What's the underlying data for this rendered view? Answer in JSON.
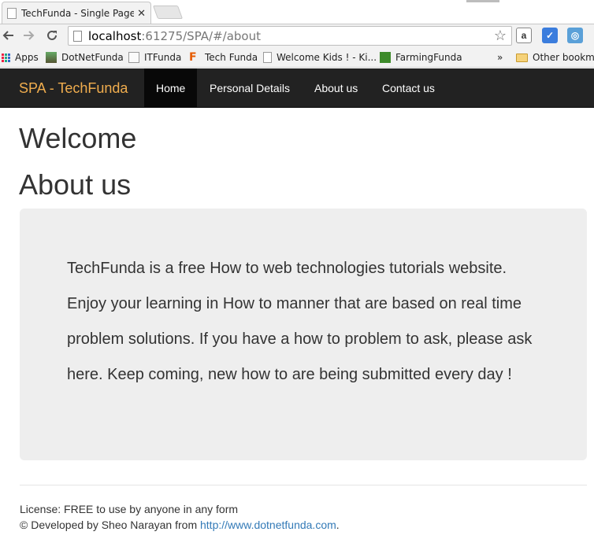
{
  "browser": {
    "tab_title": "TechFunda - Single Page A",
    "tab_close": "✕",
    "url_host": "localhost",
    "url_rest": ":61275/SPA/#/about",
    "icons": [
      "back-icon",
      "forward-icon",
      "reload-icon",
      "star-icon"
    ],
    "bookmarks": [
      {
        "label": "Apps",
        "icon": "apps-icon"
      },
      {
        "label": "DotNetFunda",
        "icon": "dotnetfunda-icon"
      },
      {
        "label": "ITFunda",
        "icon": "itfunda-icon"
      },
      {
        "label": "Tech Funda",
        "icon": "techfunda-icon"
      },
      {
        "label": "Welcome Kids ! - Ki...",
        "icon": "page-icon"
      },
      {
        "label": "FarmingFunda",
        "icon": "farming-icon"
      }
    ],
    "overflow": "»",
    "other_bookmarks": "Other bookma"
  },
  "navbar": {
    "brand": "SPA - TechFunda",
    "items": [
      {
        "label": "Home",
        "active": true
      },
      {
        "label": "Personal Details",
        "active": false
      },
      {
        "label": "About us",
        "active": false
      },
      {
        "label": "Contact us",
        "active": false
      }
    ],
    "colors": {
      "background": "#222222",
      "brand": "#f0ad4e",
      "active_bg": "#080808"
    }
  },
  "main": {
    "welcome_heading": "Welcome",
    "about_heading": "About us",
    "about_text": "TechFunda is a free How to web technologies tutorials website. Enjoy your learning in How to manner that are based on real time problem solutions. If you have a how to problem to ask, please ask here. Keep coming, new how to are being submitted every day !"
  },
  "footer": {
    "license": "License: FREE to use by anyone in any form",
    "developed_prefix": "© Developed by Sheo Narayan from ",
    "link_text": "http://www.dotnetfunda.com",
    "suffix": "."
  }
}
